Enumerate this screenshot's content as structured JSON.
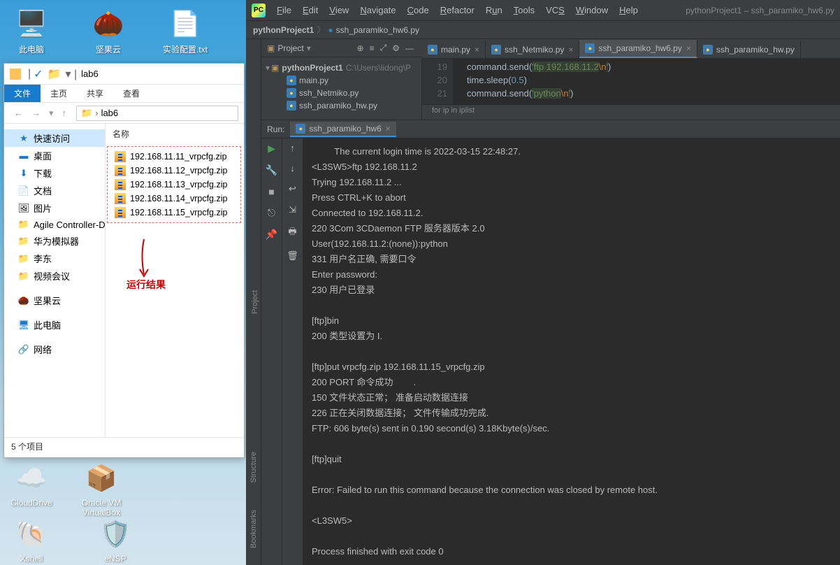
{
  "desktop": {
    "icons_top": [
      {
        "label": "此电脑",
        "glyph": "🖥️"
      },
      {
        "label": "坚果云",
        "glyph": "🌰"
      },
      {
        "label": "实验配置.txt",
        "glyph": "📄"
      }
    ],
    "icons_bottom": [
      {
        "label": "CloudDrive",
        "glyph": "☁️"
      },
      {
        "label": "Oracle VM VirtualBox",
        "glyph": "📦"
      }
    ],
    "icons_bottom2": [
      {
        "label": "Xshell",
        "glyph": "🐚"
      },
      {
        "label": "eNSP",
        "glyph": "🛡️"
      }
    ]
  },
  "explorer": {
    "titlebar_path": "lab6",
    "tabs": {
      "file": "文件",
      "home": "主页",
      "share": "共享",
      "view": "查看"
    },
    "nav_path_folder": "lab6",
    "sidebar": {
      "quick_access": "快速访问",
      "items1": [
        {
          "label": "桌面",
          "glyph": "▬"
        },
        {
          "label": "下载",
          "glyph": "⬇"
        },
        {
          "label": "文档",
          "glyph": "📄"
        },
        {
          "label": "图片",
          "glyph": "🖼"
        },
        {
          "label": "Agile Controller-D",
          "glyph": "📁"
        },
        {
          "label": "华为模拟器",
          "glyph": "📁"
        },
        {
          "label": "李东",
          "glyph": "📁"
        },
        {
          "label": "视频会议",
          "glyph": "📁"
        }
      ],
      "nut": "坚果云",
      "this_pc": "此电脑",
      "network": "网络"
    },
    "column_header": "名称",
    "files": [
      "192.168.11.11_vrpcfg.zip",
      "192.168.11.12_vrpcfg.zip",
      "192.168.11.13_vrpcfg.zip",
      "192.168.11.14_vrpcfg.zip",
      "192.168.11.15_vrpcfg.zip"
    ],
    "annotation": "运行结果",
    "status": "5 个项目"
  },
  "pycharm": {
    "menus": [
      "File",
      "Edit",
      "View",
      "Navigate",
      "Code",
      "Refactor",
      "Run",
      "Tools",
      "VCS",
      "Window",
      "Help"
    ],
    "title_right": "pythonProject1 – ssh_paramiko_hw6.py",
    "breadcrumb": {
      "proj": "pythonProject1",
      "file": "ssh_paramiko_hw6.py"
    },
    "left_gutter_top": "Project",
    "left_gutter_bottom": [
      "Structure",
      "Bookmarks"
    ],
    "project_panel": {
      "title": "Project",
      "root": "pythonProject1",
      "root_path": "C:\\Users\\lidong\\P",
      "files": [
        "main.py",
        "ssh_Netmiko.py",
        "ssh_paramiko_hw.py"
      ]
    },
    "editor_tabs": [
      {
        "label": "main.py",
        "active": false
      },
      {
        "label": "ssh_Netmiko.py",
        "active": false
      },
      {
        "label": "ssh_paramiko_hw6.py",
        "active": true
      },
      {
        "label": "ssh_paramiko_hw.py",
        "active": false
      }
    ],
    "code": {
      "line_nums": [
        "19",
        "20",
        "21"
      ],
      "lines": [
        {
          "pre": "command.send(",
          "str": "'ftp 192.168.11.2",
          "esc": "\\n",
          "str2": "'",
          "post": ")"
        },
        {
          "pre": "time.sleep(",
          "num": "0.5",
          "post": ")"
        },
        {
          "pre": "command.send(",
          "str": "'python",
          "esc": "\\n",
          "str2": "'",
          "post": ")"
        }
      ],
      "crumb": "for ip in iplist"
    },
    "run": {
      "label": "Run:",
      "tab": "ssh_paramiko_hw6",
      "output": [
        "         The current login time is 2022-03-15 22:48:27.",
        "<L3SW5>ftp 192.168.11.2",
        "Trying 192.168.11.2 ...",
        "Press CTRL+K to abort",
        "Connected to 192.168.11.2.",
        "220 3Com 3CDaemon FTP 服务器版本 2.0",
        "User(192.168.11.2:(none)):python",
        "331 用户名正确, 需要口令",
        "Enter password:",
        "230 用户已登录",
        "",
        "[ftp]bin",
        "200 类型设置为 I.",
        "",
        "[ftp]put vrpcfg.zip 192.168.11.15_vrpcfg.zip",
        "200 PORT 命令成功        .",
        "150 文件状态正常； 准备启动数据连接",
        "226 正在关闭数据连接； 文件传输成功完成.",
        "FTP: 606 byte(s) sent in 0.190 second(s) 3.18Kbyte(s)/sec.",
        "",
        "[ftp]quit",
        "",
        "Error: Failed to run this command because the connection was closed by remote host.",
        "",
        "<L3SW5>",
        "",
        "Process finished with exit code 0"
      ]
    }
  }
}
